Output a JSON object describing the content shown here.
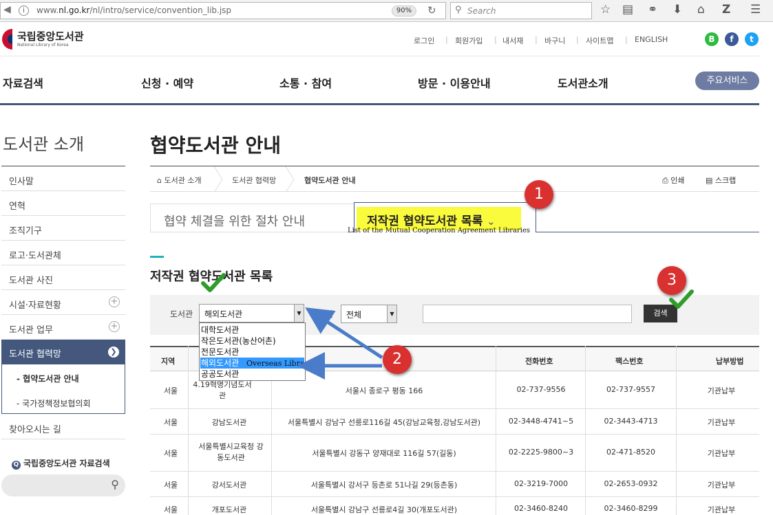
{
  "browser": {
    "url_prefix": "www.",
    "url_domain": "nl.go.kr",
    "url_path": "/nl/intro/service/convention_lib.jsp",
    "zoom": "90%",
    "search_placeholder": "Search"
  },
  "header": {
    "logo_text": "국립중앙도서관",
    "logo_sub": "National Library of Korea",
    "util_links": [
      "로그인",
      "회원가입",
      "내서재",
      "바구니",
      "사이트맵",
      "ENGLISH"
    ],
    "sns": [
      "B",
      "f",
      "t"
    ]
  },
  "gnb": {
    "items": [
      "자료검색",
      "신청 · 예약",
      "소통 · 참여",
      "방문 · 이용안내",
      "도서관소개"
    ],
    "main_service": "주요서비스"
  },
  "sidebar": {
    "title": "도서관 소개",
    "items": [
      "인사말",
      "연혁",
      "조직기구",
      "로고·도서관체",
      "도서관 사진",
      "시설·자료현황",
      "도서관 업무"
    ],
    "active": "도서관 협력망",
    "sub_items": [
      "협약도서관 안내",
      "국가정책정보협의회"
    ],
    "after": "찾아오시는 길",
    "search_label": "국립중앙도서관 자료검색"
  },
  "content": {
    "page_title": "협약도서관 안내",
    "breadcrumb": [
      "도서관 소개",
      "도서관 협력망",
      "협약도서관 안내"
    ],
    "tools": [
      "인쇄",
      "스크랩"
    ],
    "tab_left": "협약 체결을 위한 절차 안내",
    "tab_right": "저작권 협약도서관 목록",
    "annotation_en": "List of the Mutual Cooperation Agreement Libraries",
    "section_title": "저작권 협약도서관 목록",
    "filter": {
      "library_label": "도서관",
      "library_value": "해외도서관",
      "region_label": "지역",
      "region_value": "전체",
      "search_button": "검색"
    },
    "dropdown_options": [
      "대학도서관",
      "작은도서관(농산어촌)",
      "전문도서관",
      "해외도서관",
      "공공도서관"
    ],
    "dropdown_selected_index": 3,
    "annotation_overseas": "Overseas Library",
    "badges": [
      "1",
      "2",
      "3"
    ]
  },
  "table": {
    "headers": [
      "지역",
      "",
      "",
      "전화번호",
      "팩스번호",
      "납부방법"
    ],
    "rows": [
      {
        "region": "서울",
        "name": "4.19혁명기념도서관",
        "address": "서울시 종로구 평동 166",
        "phone": "02-737-9556",
        "fax": "02-737-9557",
        "pay": "기관납부"
      },
      {
        "region": "서울",
        "name": "강남도서관",
        "address": "서울특별시 강남구 선릉로116길 45(강남교육청,강남도서관)",
        "phone": "02-3448-4741~5",
        "fax": "02-3443-4713",
        "pay": "기관납부"
      },
      {
        "region": "서울",
        "name": "서울특별시교육청 강동도서관",
        "address": "서울특별시 강동구 양재대로 116길 57(길동)",
        "phone": "02-2225-9800~3",
        "fax": "02-471-8520",
        "pay": "기관납부"
      },
      {
        "region": "서울",
        "name": "강서도서관",
        "address": "서울특별시 강서구 등촌로 51나길 29(등촌동)",
        "phone": "02-3219-7000",
        "fax": "02-2653-0932",
        "pay": "기관납부"
      },
      {
        "region": "서울",
        "name": "개포도서관",
        "address": "서울특별시 강남구 선릉로4길 30(개포도서관)",
        "phone": "02-3460-8240",
        "fax": "02-3460-8299",
        "pay": "기관납부"
      }
    ]
  }
}
